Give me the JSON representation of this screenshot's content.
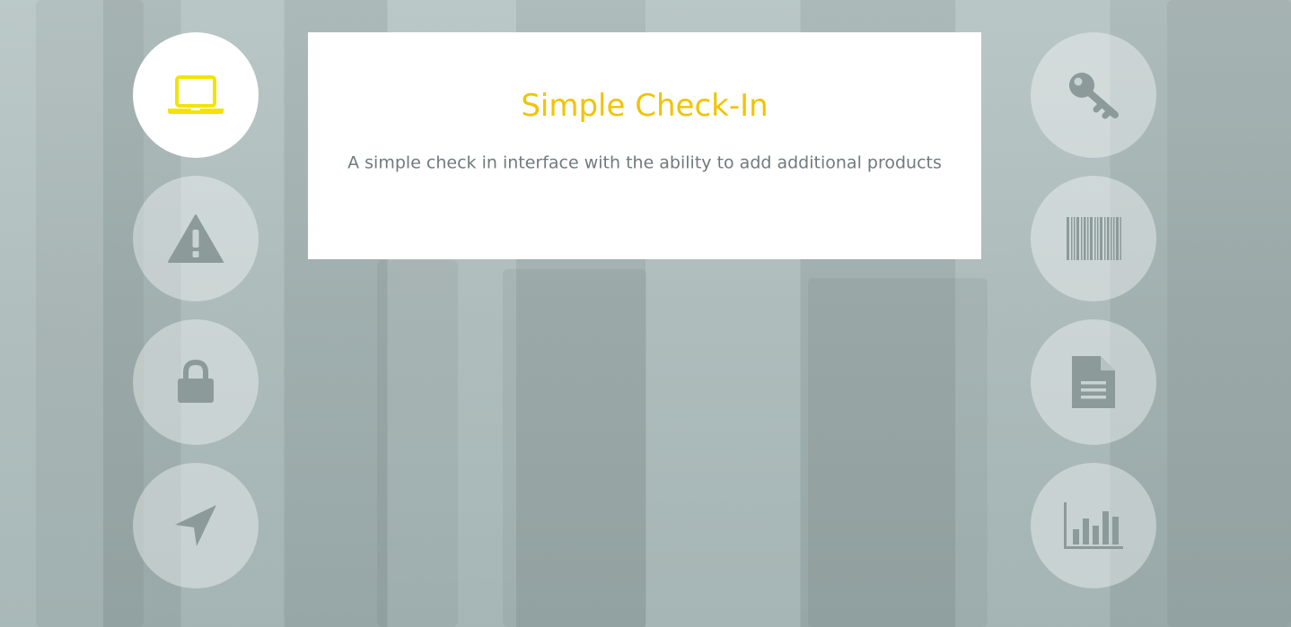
{
  "card": {
    "title": "Simple Check-In",
    "description": "A simple check in interface with the ability to add additional products"
  },
  "left_nav": [
    {
      "icon": "laptop-icon",
      "active": true
    },
    {
      "icon": "warning-icon",
      "active": false
    },
    {
      "icon": "lock-icon",
      "active": false
    },
    {
      "icon": "navigation-arrow-icon",
      "active": false
    }
  ],
  "right_nav": [
    {
      "icon": "key-icon",
      "active": false
    },
    {
      "icon": "barcode-icon",
      "active": false
    },
    {
      "icon": "document-icon",
      "active": false
    },
    {
      "icon": "bar-chart-icon",
      "active": false
    }
  ],
  "colors": {
    "accent": "#f2c300",
    "icon_inactive": "#8c9a9a",
    "description_text": "#707a7d",
    "card_background": "#ffffff"
  }
}
